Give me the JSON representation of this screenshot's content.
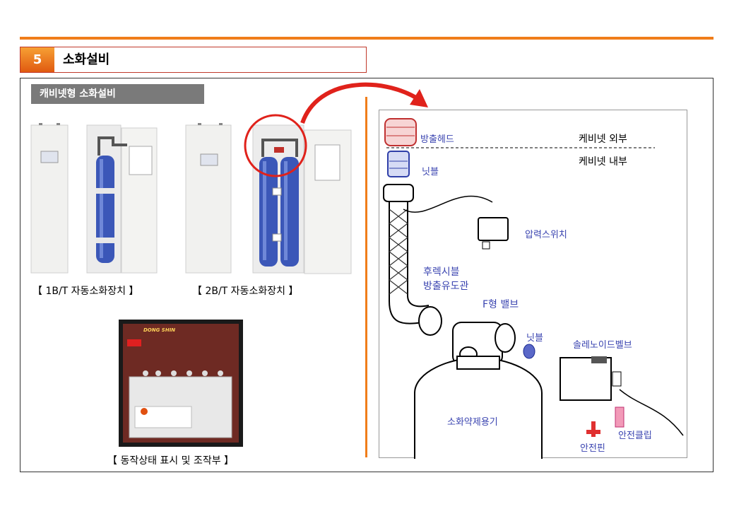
{
  "section": {
    "number": "5",
    "title": "소화설비"
  },
  "sub_label": "캐비넷형 소화설비",
  "captions": {
    "cabinet_1b": "【 1B/T 자동소화장치 】",
    "cabinet_2b": "【 2B/T 자동소화장치 】",
    "panel": "【 동작상태 표시 및 조작부 】"
  },
  "panel_brand": "DONG SHIN",
  "diagram": {
    "outside": "케비넷 외부",
    "inside": "케비넷 내부",
    "labels": {
      "discharge_head": "방출헤드",
      "nipple_top": "닛블",
      "pressure_switch": "압력스위치",
      "flex_hose_1": "후렉시블",
      "flex_hose_2": "방출유도관",
      "f_valve": "F형 밸브",
      "nipple_mid": "닛블",
      "solenoid": "솔레노이드벨브",
      "container": "소화약제용기",
      "safety_clip": "안전클립",
      "safety_pin": "안전핀"
    }
  }
}
